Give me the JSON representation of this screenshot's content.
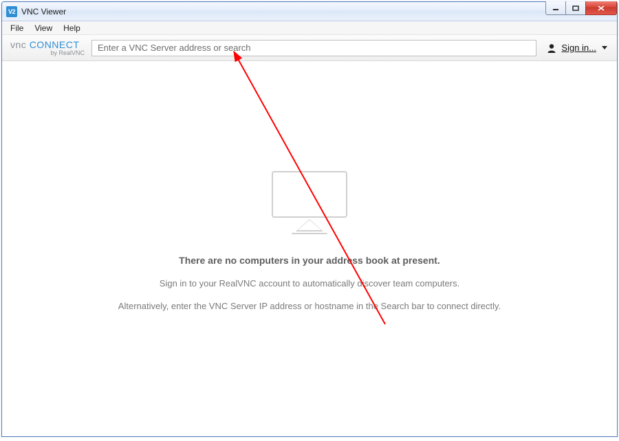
{
  "window": {
    "title": "VNC Viewer",
    "icon_text": "V2"
  },
  "menubar": {
    "items": [
      "File",
      "View",
      "Help"
    ]
  },
  "brand": {
    "left": "vnc",
    "right": "connect",
    "byline": "by RealVNC"
  },
  "search": {
    "placeholder": "Enter a VNC Server address or search",
    "value": ""
  },
  "signin": {
    "label": "Sign in..."
  },
  "empty_state": {
    "heading": "There are no computers in your address book at present.",
    "line1": "Sign in to your RealVNC account to automatically discover team computers.",
    "line2": "Alternatively, enter the VNC Server IP address or hostname in the Search bar to connect directly."
  }
}
